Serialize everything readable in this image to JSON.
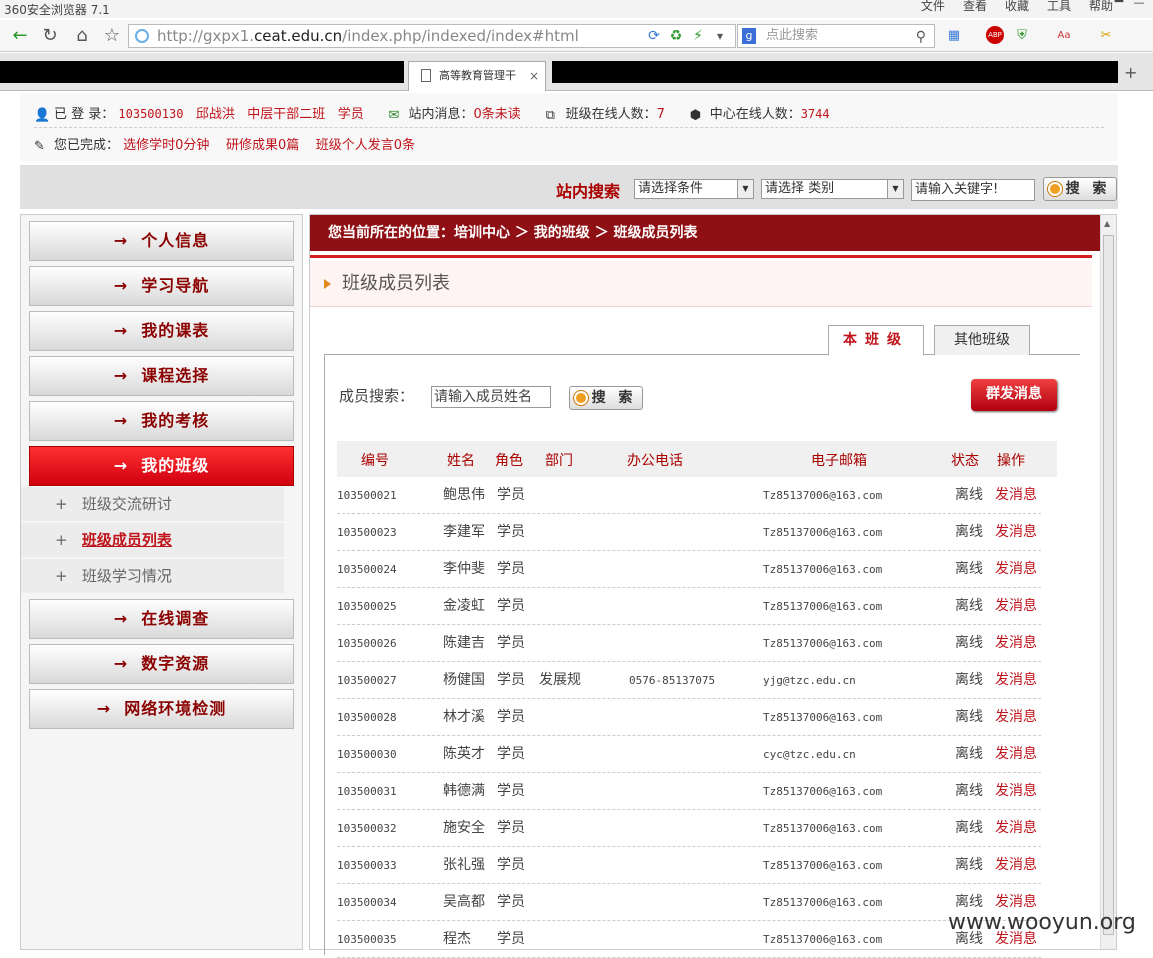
{
  "browser": {
    "title": "360安全浏览器 7.1",
    "menu": [
      "文件",
      "查看",
      "收藏",
      "工具",
      "帮助"
    ],
    "url_prefix": "http://gxpx1.",
    "url_domain": "ceat.edu.cn",
    "url_suffix": "/index.php/indexed/index#html",
    "search_placeholder": "点此搜索",
    "tab_title": "高等教育管理干"
  },
  "userbar": {
    "login_label": "已 登 录：",
    "user_id": "103500130",
    "user_name": "邱战洪",
    "class_name": "中层干部二班",
    "role": "学员",
    "msg_label": "站内消息：",
    "msg_value": "0条未读",
    "class_online_label": "班级在线人数：",
    "class_online": "7",
    "center_online_label": "中心在线人数：",
    "center_online": "3744",
    "done_label": "您已完成：",
    "done_study": "选修学时0分钟",
    "done_result": "研修成果0篇",
    "done_speech": "班级个人发言0条"
  },
  "site_search": {
    "label": "站内搜索",
    "condition": "请选择条件",
    "category": "请选择 类别",
    "keyword": "请输入关键字!",
    "button": "搜 索"
  },
  "sidebar": {
    "items": [
      {
        "label": "个人信息"
      },
      {
        "label": "学习导航"
      },
      {
        "label": "我的课表"
      },
      {
        "label": "课程选择"
      },
      {
        "label": "我的考核"
      },
      {
        "label": "我的班级"
      },
      {
        "label": "在线调查"
      },
      {
        "label": "数字资源"
      },
      {
        "label": "网络环境检测"
      }
    ],
    "subitems": [
      {
        "label": "班级交流研讨"
      },
      {
        "label": "班级成员列表"
      },
      {
        "label": "班级学习情况"
      }
    ],
    "arrow": "→",
    "plus": "+"
  },
  "main": {
    "breadcrumb": "您当前所在的位置：培训中心 ＞ 我的班级 ＞ 班级成员列表",
    "page_title": "班级成员列表",
    "tab_this": "本班级",
    "tab_other": "其他班级",
    "member_search_label": "成员搜索：",
    "member_search_placeholder": "请输入成员姓名",
    "search_button": "搜 索",
    "group_msg_button": "群发消息",
    "columns": [
      "编号",
      "姓名",
      "角色",
      "部门",
      "办公电话",
      "电子邮箱",
      "状态",
      "操作"
    ],
    "rows": [
      {
        "id": "103500021",
        "name": "鲍思伟",
        "role": "学员",
        "dept": "",
        "tel": "",
        "email": "Tz85137006@163.com",
        "status": "离线",
        "action": "发消息"
      },
      {
        "id": "103500023",
        "name": "李建军",
        "role": "学员",
        "dept": "",
        "tel": "",
        "email": "Tz85137006@163.com",
        "status": "离线",
        "action": "发消息"
      },
      {
        "id": "103500024",
        "name": "李仲斐",
        "role": "学员",
        "dept": "",
        "tel": "",
        "email": "Tz85137006@163.com",
        "status": "离线",
        "action": "发消息"
      },
      {
        "id": "103500025",
        "name": "金凌虹",
        "role": "学员",
        "dept": "",
        "tel": "",
        "email": "Tz85137006@163.com",
        "status": "离线",
        "action": "发消息"
      },
      {
        "id": "103500026",
        "name": "陈建吉",
        "role": "学员",
        "dept": "",
        "tel": "",
        "email": "Tz85137006@163.com",
        "status": "离线",
        "action": "发消息"
      },
      {
        "id": "103500027",
        "name": "杨健国",
        "role": "学员",
        "dept": "发展规",
        "tel": "0576-85137075",
        "email": "yjg@tzc.edu.cn",
        "status": "离线",
        "action": "发消息"
      },
      {
        "id": "103500028",
        "name": "林才溪",
        "role": "学员",
        "dept": "",
        "tel": "",
        "email": "Tz85137006@163.com",
        "status": "离线",
        "action": "发消息"
      },
      {
        "id": "103500030",
        "name": "陈英才",
        "role": "学员",
        "dept": "",
        "tel": "",
        "email": "cyc@tzc.edu.cn",
        "status": "离线",
        "action": "发消息"
      },
      {
        "id": "103500031",
        "name": "韩德满",
        "role": "学员",
        "dept": "",
        "tel": "",
        "email": "Tz85137006@163.com",
        "status": "离线",
        "action": "发消息"
      },
      {
        "id": "103500032",
        "name": "施安全",
        "role": "学员",
        "dept": "",
        "tel": "",
        "email": "Tz85137006@163.com",
        "status": "离线",
        "action": "发消息"
      },
      {
        "id": "103500033",
        "name": "张礼强",
        "role": "学员",
        "dept": "",
        "tel": "",
        "email": "Tz85137006@163.com",
        "status": "离线",
        "action": "发消息"
      },
      {
        "id": "103500034",
        "name": "吴高都",
        "role": "学员",
        "dept": "",
        "tel": "",
        "email": "Tz85137006@163.com",
        "status": "离线",
        "action": "发消息"
      },
      {
        "id": "103500035",
        "name": "程杰",
        "role": "学员",
        "dept": "",
        "tel": "",
        "email": "Tz85137006@163.com",
        "status": "离线",
        "action": "发消息"
      }
    ]
  },
  "watermark": "www.wooyun.org",
  "colors": {
    "accent": "#c0141c",
    "breadcrumb_bg": "#8f1014",
    "active_nav": "#e00010"
  }
}
